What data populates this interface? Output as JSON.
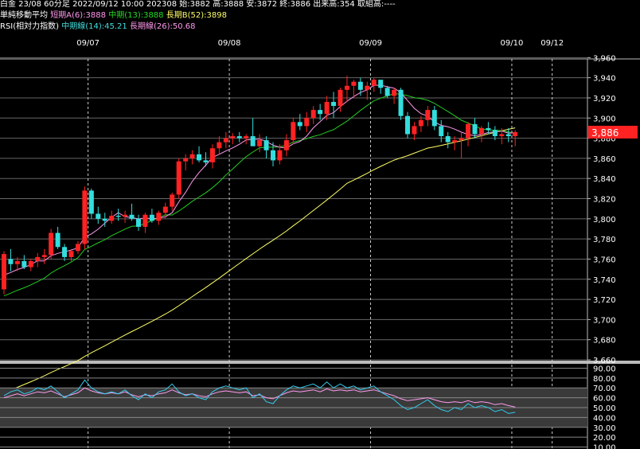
{
  "header": {
    "line1": "白金 23/08 60分足 2022/09/12 10:00 202308 始:3882 高:3888 安:3872 終:3886 出来高:354 取組高:----",
    "ma_label": "単純移動平均",
    "ma_short": "短期A(6):3888",
    "ma_mid": "中期(13):3888",
    "ma_long": "長期B(52):3898",
    "rsi_label": "RSI(相対力指数)",
    "rsi_mid": "中期線(14):45.21",
    "rsi_long": "長期線(26):50.68"
  },
  "colors": {
    "up": "#ff2222",
    "down": "#33dddd",
    "ma_short": "#ff99ee",
    "ma_mid": "#22cc22",
    "ma_long": "#ffff66",
    "rsi_mid": "#33ccee",
    "rsi_long": "#ff99ee",
    "price_badge": "#ff2222"
  },
  "chart_data": {
    "type": "candlestick",
    "date_labels": [
      {
        "index": 13,
        "label": "09/07"
      },
      {
        "index": 34,
        "label": "09/08"
      },
      {
        "index": 55,
        "label": "09/09"
      },
      {
        "index": 76,
        "label": "09/10"
      },
      {
        "index": 82,
        "label": "09/12"
      }
    ],
    "price_ticks": [
      "3,960",
      "3,940",
      "3,920",
      "3,900",
      "3,880",
      "3,860",
      "3,840",
      "3,820",
      "3,800",
      "3,780",
      "3,760",
      "3,740",
      "3,720",
      "3,700",
      "3,680",
      "3,660"
    ],
    "ylim": [
      3660,
      3965
    ],
    "last_price": "3,886",
    "candles": [
      [
        3730,
        3768,
        3725,
        3765
      ],
      [
        3760,
        3770,
        3748,
        3755
      ],
      [
        3755,
        3762,
        3748,
        3758
      ],
      [
        3758,
        3764,
        3750,
        3752
      ],
      [
        3752,
        3760,
        3748,
        3758
      ],
      [
        3758,
        3766,
        3752,
        3762
      ],
      [
        3762,
        3770,
        3755,
        3764
      ],
      [
        3764,
        3790,
        3760,
        3786
      ],
      [
        3786,
        3792,
        3770,
        3772
      ],
      [
        3772,
        3775,
        3758,
        3762
      ],
      [
        3762,
        3770,
        3758,
        3768
      ],
      [
        3768,
        3778,
        3765,
        3775
      ],
      [
        3775,
        3832,
        3770,
        3828
      ],
      [
        3828,
        3830,
        3800,
        3805
      ],
      [
        3805,
        3812,
        3795,
        3800
      ],
      [
        3800,
        3806,
        3792,
        3798
      ],
      [
        3798,
        3808,
        3795,
        3803
      ],
      [
        3803,
        3810,
        3798,
        3802
      ],
      [
        3802,
        3808,
        3796,
        3804
      ],
      [
        3804,
        3815,
        3798,
        3800
      ],
      [
        3800,
        3804,
        3788,
        3792
      ],
      [
        3792,
        3806,
        3786,
        3804
      ],
      [
        3804,
        3810,
        3796,
        3798
      ],
      [
        3798,
        3808,
        3794,
        3806
      ],
      [
        3806,
        3816,
        3800,
        3812
      ],
      [
        3812,
        3826,
        3808,
        3824
      ],
      [
        3824,
        3860,
        3820,
        3857
      ],
      [
        3857,
        3864,
        3848,
        3860
      ],
      [
        3860,
        3868,
        3854,
        3864
      ],
      [
        3864,
        3872,
        3856,
        3858
      ],
      [
        3858,
        3866,
        3852,
        3856
      ],
      [
        3856,
        3874,
        3850,
        3870
      ],
      [
        3870,
        3882,
        3864,
        3876
      ],
      [
        3876,
        3886,
        3870,
        3880
      ],
      [
        3880,
        3885,
        3874,
        3882
      ],
      [
        3882,
        3886,
        3876,
        3880
      ],
      [
        3880,
        3884,
        3874,
        3882
      ],
      [
        3882,
        3900,
        3878,
        3872
      ],
      [
        3872,
        3884,
        3866,
        3878
      ],
      [
        3878,
        3882,
        3860,
        3868
      ],
      [
        3868,
        3876,
        3852,
        3858
      ],
      [
        3858,
        3874,
        3854,
        3868
      ],
      [
        3868,
        3884,
        3862,
        3878
      ],
      [
        3878,
        3900,
        3874,
        3896
      ],
      [
        3896,
        3904,
        3888,
        3892
      ],
      [
        3892,
        3906,
        3886,
        3900
      ],
      [
        3900,
        3912,
        3894,
        3908
      ],
      [
        3908,
        3914,
        3898,
        3904
      ],
      [
        3904,
        3922,
        3898,
        3916
      ],
      [
        3916,
        3926,
        3900,
        3912
      ],
      [
        3912,
        3930,
        3906,
        3928
      ],
      [
        3928,
        3942,
        3916,
        3932
      ],
      [
        3932,
        3938,
        3920,
        3936
      ],
      [
        3936,
        3940,
        3922,
        3928
      ],
      [
        3928,
        3936,
        3918,
        3932
      ],
      [
        3932,
        3940,
        3926,
        3938
      ],
      [
        3938,
        3934,
        3924,
        3930
      ],
      [
        3930,
        3932,
        3920,
        3922
      ],
      [
        3922,
        3930,
        3914,
        3928
      ],
      [
        3928,
        3930,
        3898,
        3902
      ],
      [
        3902,
        3906,
        3880,
        3884
      ],
      [
        3884,
        3896,
        3878,
        3892
      ],
      [
        3892,
        3902,
        3886,
        3898
      ],
      [
        3898,
        3912,
        3892,
        3908
      ],
      [
        3908,
        3912,
        3888,
        3892
      ],
      [
        3892,
        3898,
        3876,
        3882
      ],
      [
        3882,
        3886,
        3870,
        3876
      ],
      [
        3876,
        3882,
        3868,
        3878
      ],
      [
        3878,
        3886,
        3860,
        3880
      ],
      [
        3880,
        3896,
        3872,
        3894
      ],
      [
        3894,
        3900,
        3880,
        3884
      ],
      [
        3884,
        3892,
        3876,
        3890
      ],
      [
        3890,
        3896,
        3884,
        3888
      ],
      [
        3888,
        3892,
        3878,
        3882
      ],
      [
        3882,
        3890,
        3874,
        3884
      ],
      [
        3884,
        3890,
        3876,
        3882
      ],
      [
        3882,
        3888,
        3872,
        3886
      ]
    ],
    "rsi_ticks": [
      "90.00",
      "80.00",
      "70.00",
      "60.00",
      "50.00",
      "40.00",
      "30.00",
      "20.00",
      "10.00"
    ],
    "rsi_ylim": [
      8,
      92
    ],
    "rsi_mid": [
      62,
      66,
      68,
      64,
      66,
      70,
      68,
      72,
      66,
      60,
      64,
      68,
      78,
      70,
      66,
      64,
      66,
      64,
      68,
      62,
      58,
      64,
      60,
      66,
      68,
      74,
      66,
      62,
      64,
      60,
      58,
      66,
      70,
      72,
      70,
      68,
      70,
      60,
      64,
      56,
      54,
      62,
      68,
      72,
      70,
      72,
      74,
      70,
      76,
      70,
      74,
      70,
      72,
      68,
      70,
      72,
      66,
      62,
      58,
      52,
      48,
      50,
      54,
      58,
      52,
      48,
      46,
      50,
      48,
      54,
      50,
      52,
      50,
      46,
      48,
      44,
      45.21
    ],
    "rsi_long": [
      60,
      62,
      64,
      62,
      64,
      66,
      65,
      67,
      64,
      61,
      63,
      65,
      70,
      67,
      65,
      64,
      65,
      64,
      66,
      63,
      61,
      63,
      62,
      64,
      65,
      68,
      65,
      63,
      64,
      62,
      61,
      64,
      66,
      67,
      66,
      65,
      66,
      62,
      63,
      60,
      59,
      62,
      65,
      67,
      66,
      67,
      68,
      66,
      69,
      67,
      68,
      67,
      68,
      66,
      67,
      68,
      66,
      64,
      62,
      59,
      57,
      58,
      59,
      60,
      58,
      56,
      55,
      56,
      55,
      57,
      55,
      56,
      55,
      53,
      54,
      52,
      50.68
    ]
  }
}
